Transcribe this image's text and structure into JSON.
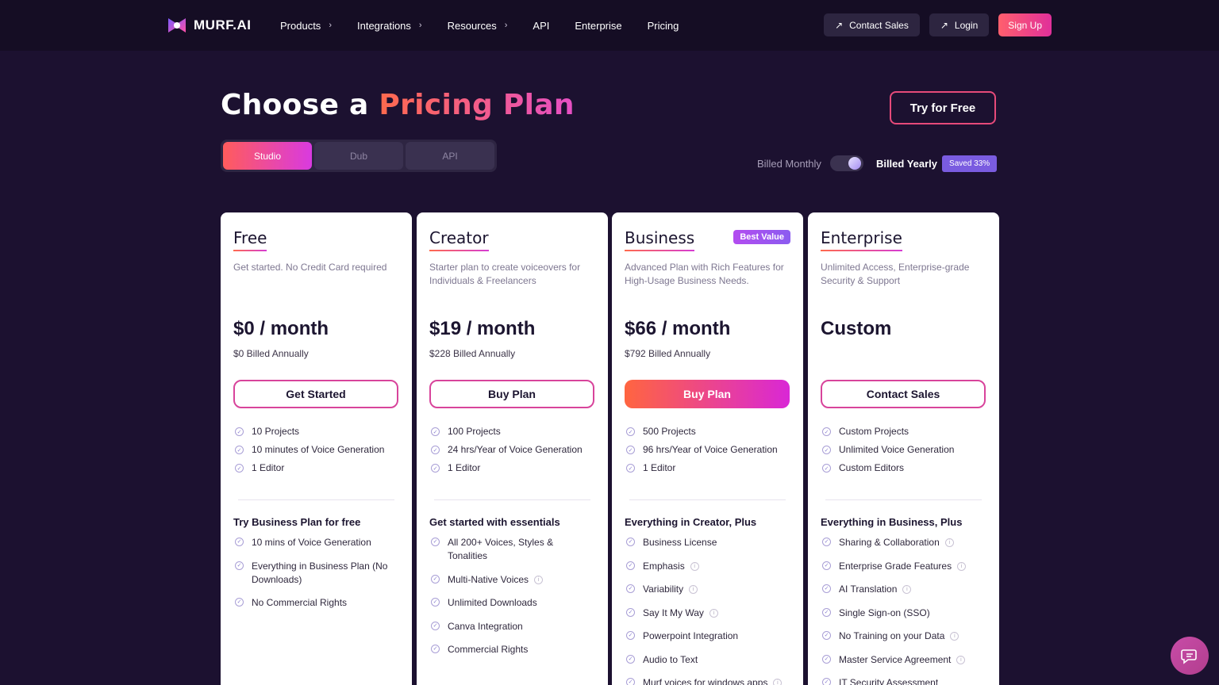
{
  "nav": {
    "logo_text": "MURF.AI",
    "links": [
      {
        "label": "Products",
        "chevron": true
      },
      {
        "label": "Integrations",
        "chevron": true
      },
      {
        "label": "Resources",
        "chevron": true
      },
      {
        "label": "API",
        "chevron": false
      },
      {
        "label": "Enterprise",
        "chevron": false
      },
      {
        "label": "Pricing",
        "chevron": false
      }
    ],
    "contact_sales": "Contact Sales",
    "login": "Login",
    "sign_up": "Sign Up"
  },
  "header": {
    "title_prefix": "Choose a ",
    "title_highlight": "Pricing Plan",
    "try_free": "Try for Free",
    "tabs": [
      "Studio",
      "Dub",
      "API"
    ],
    "active_tab": "Studio",
    "billed_monthly": "Billed Monthly",
    "billed_yearly": "Billed Yearly",
    "saved_badge": "Saved 33%"
  },
  "plans": [
    {
      "name": "Free",
      "badge": "",
      "description": "Get started. No Credit Card required",
      "price": "$0 / month",
      "billed": "$0 Billed Annually",
      "cta": "Get Started",
      "primary": false,
      "features": [
        "10 Projects",
        "10 minutes of Voice Generation",
        "1 Editor"
      ],
      "section_title": "Try Business Plan for free",
      "section_items": [
        {
          "text": "10 mins of Voice Generation",
          "info": false
        },
        {
          "text": "Everything in Business Plan (No Downloads)",
          "info": false
        },
        {
          "text": "No Commercial Rights",
          "info": false
        }
      ]
    },
    {
      "name": "Creator",
      "badge": "",
      "description": "Starter plan to create voiceovers for Individuals & Freelancers",
      "price": "$19 / month",
      "billed": "$228 Billed Annually",
      "cta": "Buy Plan",
      "primary": false,
      "features": [
        "100 Projects",
        "24 hrs/Year of Voice Generation",
        "1 Editor"
      ],
      "section_title": "Get started with essentials",
      "section_items": [
        {
          "text": "All 200+ Voices, Styles & Tonalities",
          "info": false
        },
        {
          "text": "Multi-Native Voices",
          "info": true
        },
        {
          "text": "Unlimited Downloads",
          "info": false
        },
        {
          "text": "Canva Integration",
          "info": false
        },
        {
          "text": "Commercial Rights",
          "info": false
        }
      ]
    },
    {
      "name": "Business",
      "badge": "Best Value",
      "description": "Advanced Plan with Rich Features for High-Usage Business Needs.",
      "price": "$66 / month",
      "billed": "$792 Billed Annually",
      "cta": "Buy Plan",
      "primary": true,
      "features": [
        "500 Projects",
        "96 hrs/Year of Voice Generation",
        "1 Editor"
      ],
      "section_title": "Everything in Creator, Plus",
      "section_items": [
        {
          "text": "Business License",
          "info": false
        },
        {
          "text": "Emphasis",
          "info": true
        },
        {
          "text": "Variability",
          "info": true
        },
        {
          "text": "Say It My Way",
          "info": true
        },
        {
          "text": "Powerpoint Integration",
          "info": false
        },
        {
          "text": "Audio to Text",
          "info": false
        },
        {
          "text": "Murf voices for windows apps",
          "info": true
        }
      ]
    },
    {
      "name": "Enterprise",
      "badge": "",
      "description": "Unlimited Access, Enterprise-grade Security & Support",
      "price": "Custom",
      "billed": "",
      "cta": "Contact Sales",
      "primary": false,
      "features": [
        "Custom Projects",
        "Unlimited Voice Generation",
        "Custom Editors"
      ],
      "section_title": "Everything in Business, Plus",
      "section_items": [
        {
          "text": "Sharing & Collaboration",
          "info": true
        },
        {
          "text": "Enterprise Grade Features",
          "info": true
        },
        {
          "text": "AI Translation",
          "info": true
        },
        {
          "text": "Single Sign-on (SSO)",
          "info": false
        },
        {
          "text": "No Training on your Data",
          "info": true
        },
        {
          "text": "Master Service Agreement",
          "info": true
        },
        {
          "text": "IT Security Assessment",
          "info": false
        }
      ]
    }
  ]
}
